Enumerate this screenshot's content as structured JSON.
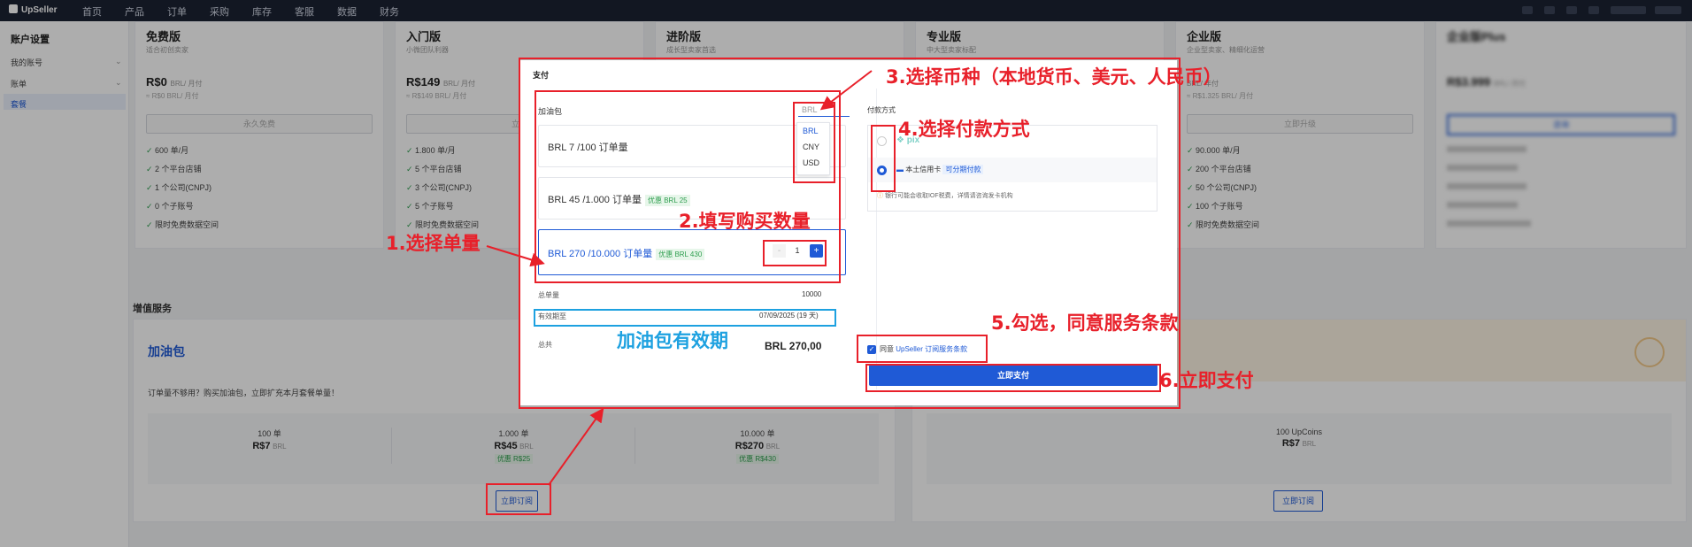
{
  "nav": {
    "logo": "UpSeller",
    "items": [
      "首页",
      "产品",
      "订单",
      "采购",
      "库存",
      "客服",
      "数据",
      "财务"
    ]
  },
  "sidebar": {
    "title": "账户设置",
    "items": [
      {
        "label": "我的账号",
        "has_chevron": true
      },
      {
        "label": "账单",
        "has_chevron": true
      },
      {
        "label": "套餐",
        "has_chevron": false
      }
    ]
  },
  "plans": [
    {
      "name": "免费版",
      "desc": "适合初创卖家",
      "price": "R$0",
      "unit": "BRL/ 月付",
      "sub": "≈ R$0 BRL/ 月付",
      "button": "永久免费",
      "features": [
        "600 单/月",
        "2 个平台店铺",
        "1 个公司(CNPJ)",
        "0 个子账号",
        "限时免费数据空间"
      ]
    },
    {
      "name": "入门版",
      "desc": "小微团队利器",
      "price": "R$149",
      "unit": "BRL/ 月付",
      "sub": "≈ R$149 BRL/ 月付",
      "button": "立即",
      "features": [
        "1.800 单/月",
        "5 个平台店铺",
        "3 个公司(CNPJ)",
        "5 个子账号",
        "限时免费数据空间"
      ]
    },
    {
      "name": "进阶版",
      "desc": "成长型卖家首选",
      "price": "",
      "unit": "",
      "sub": "",
      "button": "",
      "features": []
    },
    {
      "name": "专业版",
      "desc": "中大型卖家标配",
      "price": "",
      "unit": "",
      "sub": "",
      "button": "",
      "features": []
    },
    {
      "name": "企业版",
      "desc": "企业型卖家、精细化运营",
      "price": "",
      "unit": "BRL/ 年付",
      "sub": "≈ R$1.325 BRL/ 月付",
      "button": "立即升级",
      "features": [
        "90.000 单/月",
        "200 个平台店铺",
        "50 个公司(CNPJ)",
        "100 个子账号",
        "限时免费数据空间"
      ]
    },
    {
      "name": "企业版Plus",
      "desc": "",
      "price": "R$3.999",
      "unit": "BRL/ 月付",
      "sub": "",
      "button": "咨询",
      "features": []
    }
  ],
  "addons": {
    "section_title": "增值服务",
    "fuel": {
      "title": "加油包",
      "desc": "订单量不够用？购买加油包，立即扩充本月套餐单量！",
      "packs": [
        {
          "qty": "100 单",
          "price": "R$7",
          "currency": "BRL",
          "discount": ""
        },
        {
          "qty": "1.000 单",
          "price": "R$45",
          "currency": "BRL",
          "discount": "优惠 R$25"
        },
        {
          "qty": "10.000 单",
          "price": "R$270",
          "currency": "BRL",
          "discount": "优惠 R$430"
        }
      ],
      "button": "立即订阅"
    },
    "coins": {
      "qty": "100 UpCoins",
      "price": "R$7",
      "currency": "BRL",
      "button": "立即订阅"
    }
  },
  "modal": {
    "title": "支付",
    "fuel_label": "加油包",
    "currency_selected": "BRL",
    "currency_options": [
      "BRL",
      "CNY",
      "USD"
    ],
    "options": [
      {
        "label": "BRL 7 /100 订单量",
        "discount": ""
      },
      {
        "label": "BRL 45 /1.000 订单量",
        "discount": "优惠 BRL 25"
      },
      {
        "label": "BRL 270 /10.000 订单量",
        "discount": "优惠 BRL 430"
      }
    ],
    "quantity": "1",
    "minus": "-",
    "plus": "+",
    "total_qty_label": "总单量",
    "total_qty": "10000",
    "valid_label": "有效期至",
    "valid_value": "07/09/2025 (19 天)",
    "total_label": "总共",
    "total_value": "BRL 270,00",
    "pay_method_label": "付款方式",
    "pix": "pix",
    "card": "本土信用卡",
    "card_tag": "可分期付款",
    "notice": "银行可能会收取IOF税费，详情请咨询发卡机构",
    "agree_prefix": "同意",
    "agree_link": "UpSeller 订阅服务条款",
    "pay_button": "立即支付"
  },
  "annotations": {
    "a1": "1.选择单量",
    "a2": "2.填写购买数量",
    "a3": "3.选择币种（本地货币、美元、人民币）",
    "a4": "4.选择付款方式",
    "a5": "5.勾选，同意服务条款",
    "a6": "6.立即支付",
    "validity": "加油包有效期"
  },
  "colors": {
    "accent": "#1f5ad6",
    "annotation_red": "#e8202a",
    "annotation_blue": "#1da1e0",
    "nav_bg": "#1b2233"
  }
}
